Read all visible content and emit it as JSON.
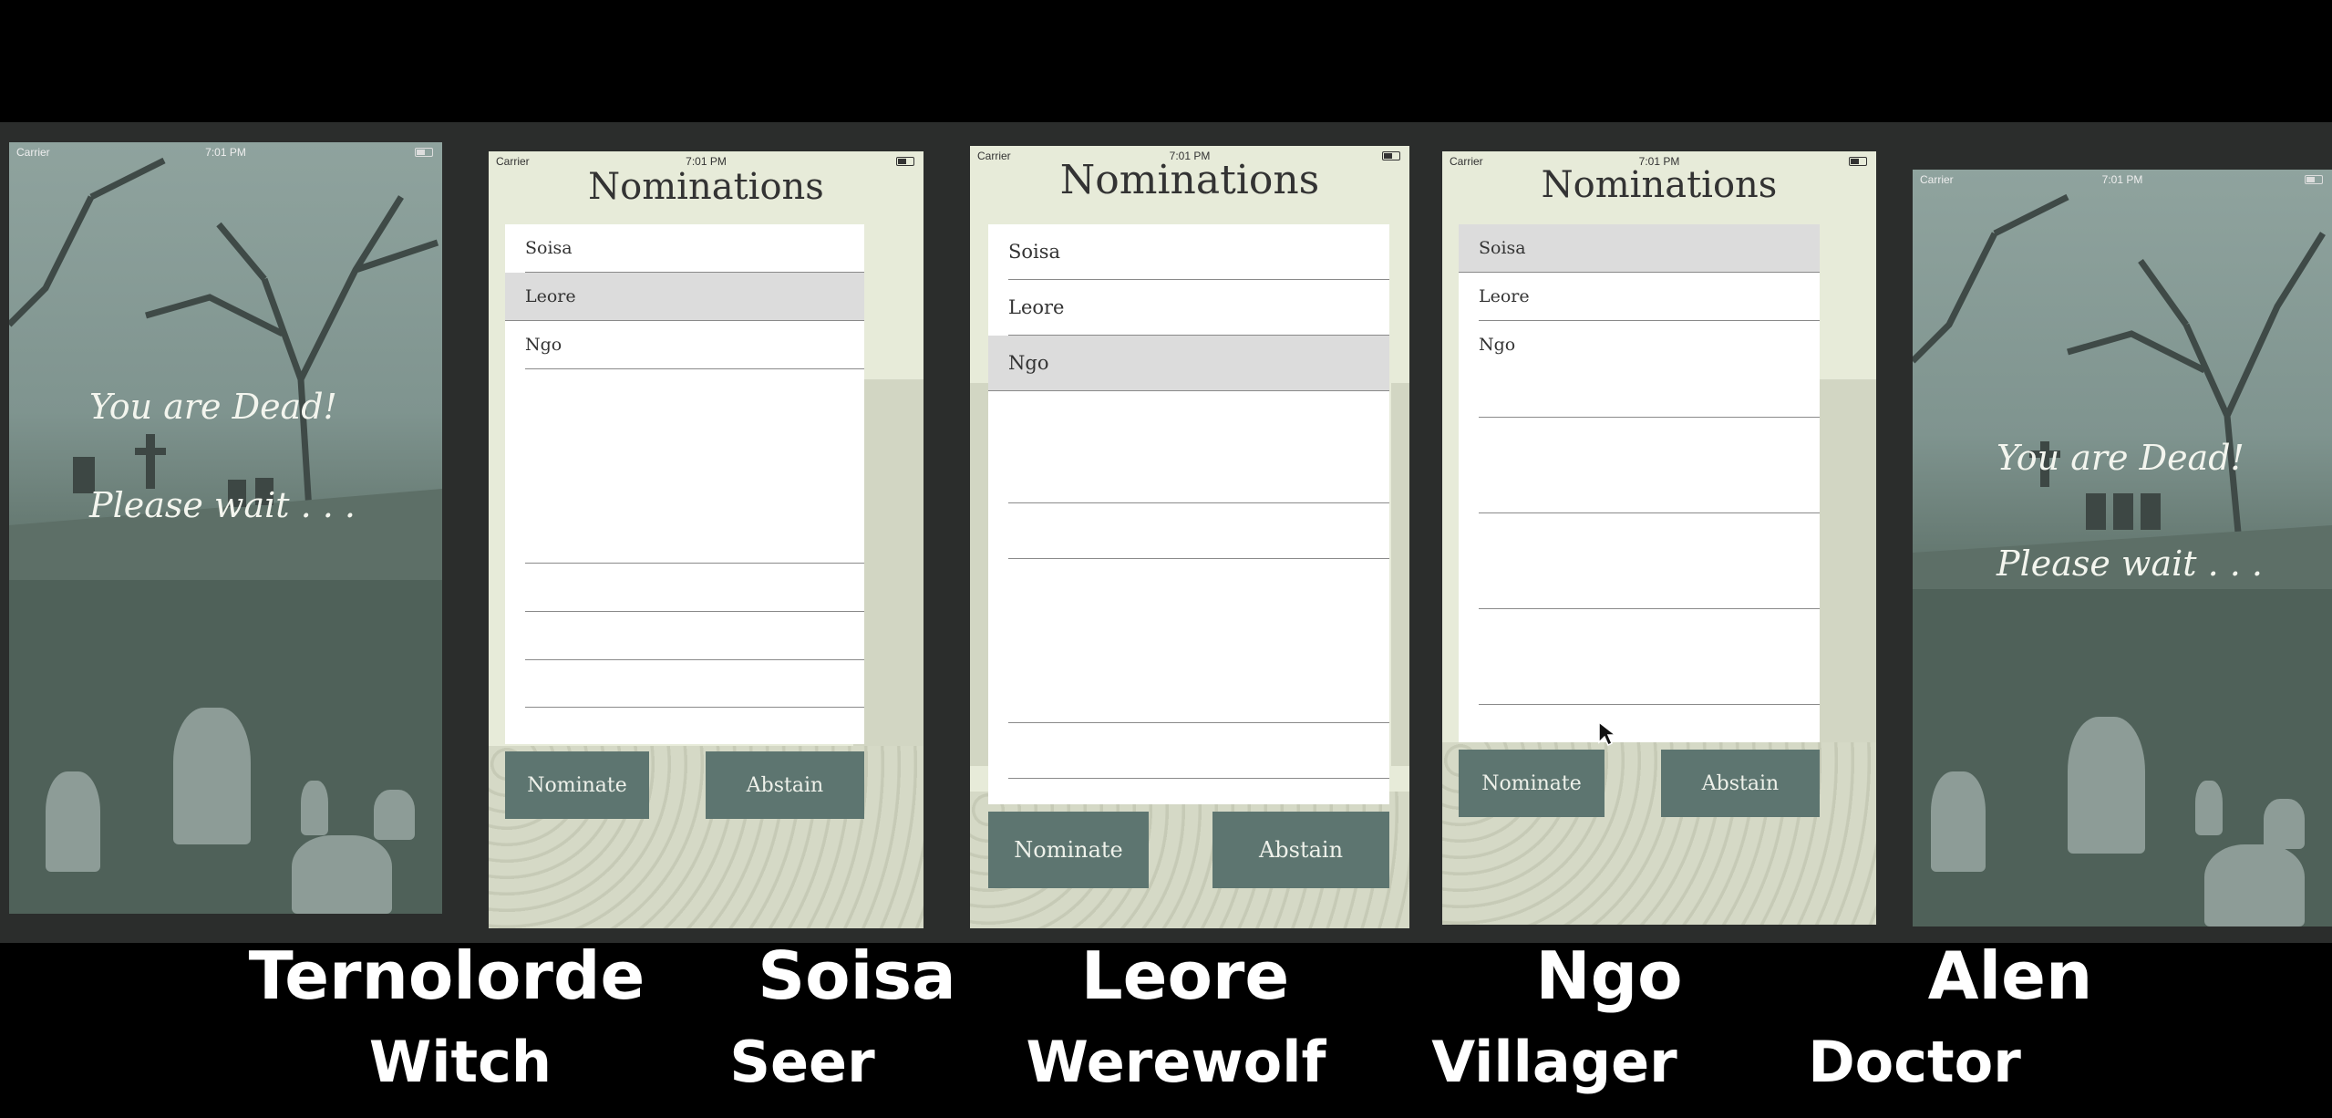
{
  "status": {
    "carrier": "Carrier",
    "time": "7:01 PM"
  },
  "dead_screen": {
    "line1": "You are Dead!",
    "line2": "Please wait . . ."
  },
  "nomination_screen": {
    "title": "Nominations",
    "nominate_label": "Nominate",
    "abstain_label": "Abstain"
  },
  "phones": [
    {
      "player": "Ternolorde",
      "role": "Witch"
    },
    {
      "player": "Soisa",
      "role": "Seer",
      "selected": "Leore",
      "candidates": [
        "Soisa",
        "Leore",
        "Ngo"
      ]
    },
    {
      "player": "Leore",
      "role": "Werewolf",
      "selected": "Ngo",
      "candidates": [
        "Soisa",
        "Leore",
        "Ngo"
      ]
    },
    {
      "player": "Ngo",
      "role": "Villager",
      "selected": "Soisa",
      "candidates": [
        "Soisa",
        "Leore",
        "Ngo"
      ]
    },
    {
      "player": "Alen",
      "role": "Doctor"
    }
  ],
  "colors": {
    "button": "#5d7570",
    "selected_row": "#dcdcdc",
    "parchment": "#e7ebd9"
  }
}
